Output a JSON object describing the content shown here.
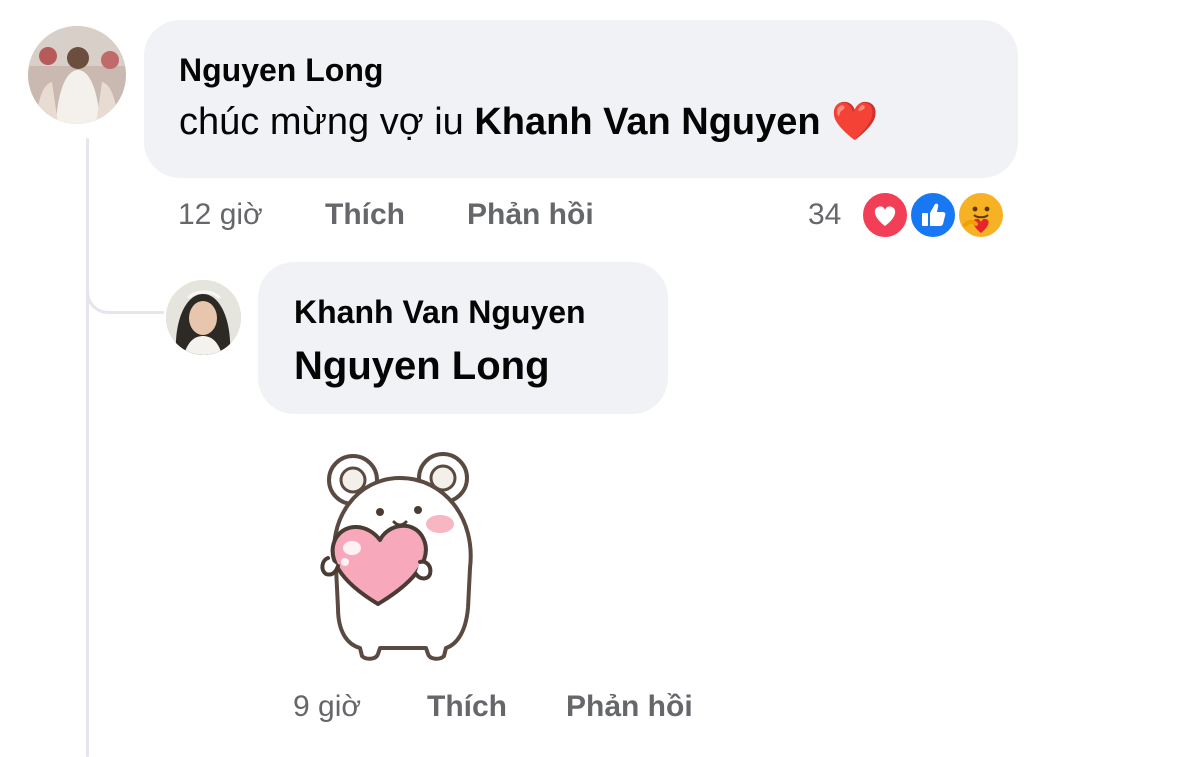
{
  "comment": {
    "author": "Nguyen Long",
    "text_prefix": "chúc mừng vợ iu",
    "mention": "Khanh Van Nguyen",
    "emoji": "❤️",
    "time": "12 giờ",
    "like_label": "Thích",
    "reply_label": "Phản hồi",
    "reaction_count": "34",
    "reactions": [
      "love-reaction-icon",
      "like-reaction-icon",
      "care-reaction-icon"
    ]
  },
  "reply": {
    "author": "Khanh Van Nguyen",
    "mention": "Nguyen Long",
    "sticker": "bear-holding-heart-sticker",
    "time": "9 giờ",
    "like_label": "Thích",
    "reply_label": "Phản hồi"
  },
  "colors": {
    "bubble": "#f0f2f5",
    "meta_text": "#65676b",
    "thread_line": "#e4e6eb",
    "love": "#f33e58",
    "like": "#1877f2",
    "care": "#f7b125"
  }
}
